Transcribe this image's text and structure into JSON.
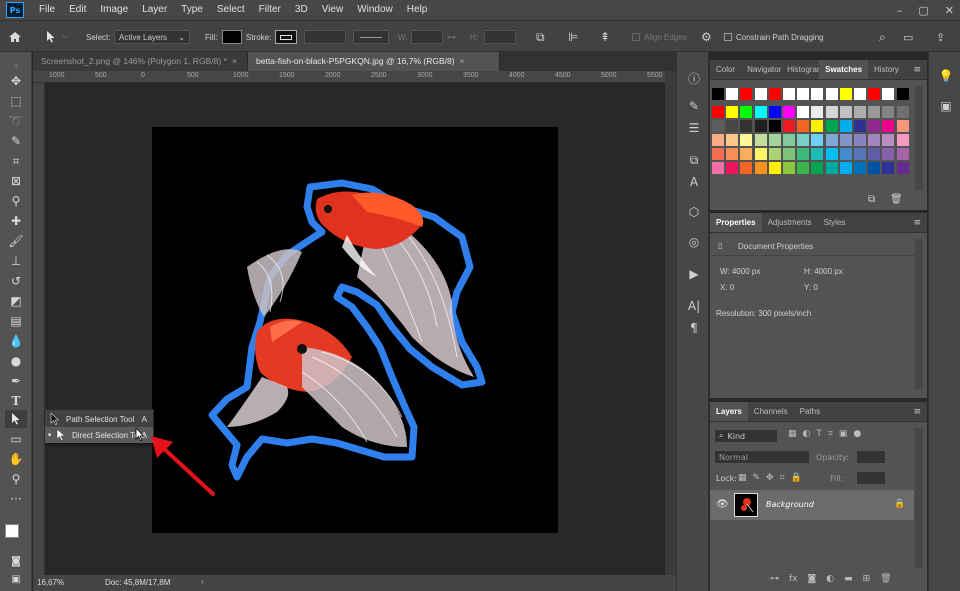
{
  "app": {
    "logo": "Ps"
  },
  "menu": [
    "File",
    "Edit",
    "Image",
    "Layer",
    "Type",
    "Select",
    "Filter",
    "3D",
    "View",
    "Window",
    "Help"
  ],
  "window_controls": {
    "minimize": "–",
    "restore": "▢",
    "close": "✕"
  },
  "options_bar": {
    "select_label": "Select:",
    "select_value": "Active Layers",
    "fill_label": "Fill:",
    "stroke_label": "Stroke:",
    "w_label": "W:",
    "h_label": "H:",
    "align_edges": "Align Edges",
    "constrain": "Constrain Path Dragging"
  },
  "tabs": [
    {
      "label": "Screenshot_2.png @ 146% (Polygon 1, RGB/8) *",
      "close": "×"
    },
    {
      "label": "betta-fish-on-black-P5PGKQN.jpg @ 16,7% (RGB/8)",
      "close": "×"
    }
  ],
  "ruler": {
    "top_ticks": [
      "1000",
      "500",
      "0",
      "500",
      "1000",
      "1500",
      "2000",
      "2500",
      "3000",
      "3500",
      "4000",
      "4500",
      "5000",
      "5500"
    ]
  },
  "status": {
    "zoom": "16,67%",
    "doc": "Doc: 45,8M/17,8M",
    "arrow": "›"
  },
  "flyout": [
    {
      "label": "Path Selection Tool",
      "shortcut": "A"
    },
    {
      "label": "Direct Selection Tool",
      "shortcut": "A",
      "bullet": "■"
    }
  ],
  "swatches_panel": {
    "tabs": [
      "Color",
      "Navigator",
      "Histogram",
      "Swatches",
      "History"
    ],
    "active": "Swatches",
    "colors": {
      "row0": [
        "#000000",
        "#ffffff",
        "#ff0000",
        "#ffffff",
        "#ff0000",
        "#ffffff",
        "#ffffff",
        "#ffffff",
        "#ffffff",
        "#ffff00",
        "#ffffff",
        "#ff0000",
        "#ffffff",
        "#000000"
      ],
      "row1": [
        "#ff0000",
        "#ffff00",
        "#00ff00",
        "#00ffff",
        "#0000ff",
        "#ff00ff",
        "#ffffff",
        "#ebebeb",
        "#d6d6d6",
        "#c2c2c2",
        "#adadad",
        "#999999",
        "#858585",
        "#707070"
      ],
      "row2": [
        "#5c5c5c",
        "#474747",
        "#333333",
        "#1f1f1f",
        "#000000",
        "#ed1c24",
        "#f26522",
        "#fff200",
        "#00a651",
        "#00aeef",
        "#2e3192",
        "#92278f",
        "#ec008c",
        "#f7977a"
      ],
      "row3": [
        "#f9ad81",
        "#fdc68a",
        "#fff79a",
        "#c4df9b",
        "#a3d39c",
        "#82ca9d",
        "#7bcdc8",
        "#6ecff6",
        "#7ea7d8",
        "#8393ca",
        "#8882be",
        "#a187be",
        "#bc8dbf",
        "#f49ac1"
      ],
      "row4": [
        "#f26c4f",
        "#f68e56",
        "#fbaf5d",
        "#fff568",
        "#acd373",
        "#7cc576",
        "#3cb878",
        "#1cbbb4",
        "#00bff3",
        "#448ccb",
        "#5574b9",
        "#605ca8",
        "#855fa8",
        "#a763a8"
      ],
      "row5": [
        "#f06eaa",
        "#ed145b",
        "#f26522",
        "#f7941d",
        "#fff200",
        "#8dc63f",
        "#39b54a",
        "#00a651",
        "#00a99d",
        "#00aeef",
        "#0072bc",
        "#0054a6",
        "#2e3192",
        "#662d91"
      ]
    }
  },
  "properties_panel": {
    "tabs": [
      "Properties",
      "Adjustments",
      "Styles"
    ],
    "title": "Document Properties",
    "w": "W:  4000 px",
    "h": "H:  4000 px",
    "x": "X:  0",
    "y": "Y:  0",
    "resolution": "Resolution: 300 pixels/inch"
  },
  "layers_panel": {
    "tabs": [
      "Layers",
      "Channels",
      "Paths"
    ],
    "kind": "Kind",
    "blend": "Normal",
    "opacity_label": "Opacity:",
    "lock_label": "Lock:",
    "fill_label": "Fill:",
    "layer_name": "Background",
    "bottom_icons": [
      "link-icon",
      "fx-icon",
      "mask-icon",
      "adjustment-icon",
      "group-icon",
      "new-layer-icon",
      "trash-icon"
    ],
    "fx_text": "fx"
  },
  "colors": {
    "selection": "#2f80ed",
    "arrow": "#e3121b",
    "canvas": "#000000"
  }
}
